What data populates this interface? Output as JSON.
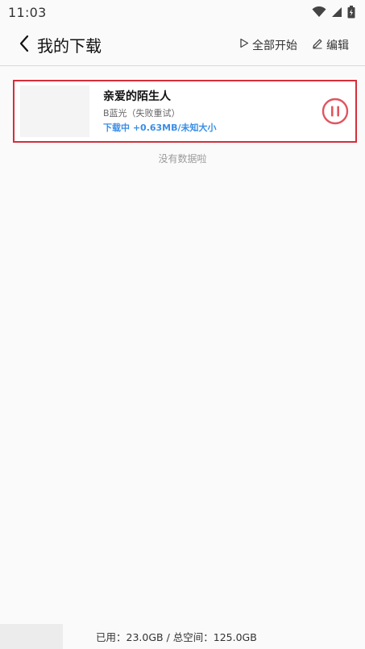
{
  "status_bar": {
    "time": "11:03",
    "icons": [
      "wifi-icon",
      "signal-icon",
      "battery-icon"
    ]
  },
  "header": {
    "title": "我的下载",
    "start_all_label": "全部开始",
    "edit_label": "编辑"
  },
  "downloads": [
    {
      "title": "亲爱的陌生人",
      "source": "B蓝光（失败重试）",
      "status": "下载中 +0.63MB/未知大小",
      "action_icon": "pause-icon"
    }
  ],
  "empty_text": "没有数据啦",
  "footer": {
    "storage": "已用：23.0GB / 总空间：125.0GB"
  },
  "colors": {
    "highlight_border": "#d32f3a",
    "pause_accent": "#e05560",
    "status_blue": "#3a8ee6"
  }
}
